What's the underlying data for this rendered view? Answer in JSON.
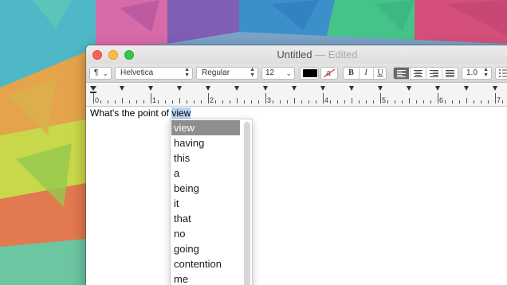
{
  "window": {
    "title": "Untitled",
    "separator": "—",
    "status": "Edited"
  },
  "toolbar": {
    "paragraph_styles_icon": "pilcrow-icon",
    "font_family": "Helvetica",
    "font_style": "Regular",
    "font_size": "12",
    "text_color": "#000000",
    "highlight_label": "a",
    "bold_label": "B",
    "italic_label": "I",
    "underline_label": "U",
    "alignment_selected": "left",
    "line_spacing": "1.0"
  },
  "ruler": {
    "marks": [
      "0",
      "1",
      "2",
      "3",
      "4",
      "5",
      "6",
      "7"
    ]
  },
  "document": {
    "text_before": "What's the point of ",
    "selected_word": "view"
  },
  "autocomplete": {
    "selected_index": 0,
    "items": [
      "view",
      "having",
      "this",
      "a",
      "being",
      "it",
      "that",
      "no",
      "going",
      "contention",
      "me"
    ]
  },
  "colors": {
    "selection_highlight": "#b5d3f3",
    "popup_selected": "#8e8e8e",
    "close": "#fc605c",
    "minimize": "#fdbc40",
    "maximize": "#34c84a"
  }
}
